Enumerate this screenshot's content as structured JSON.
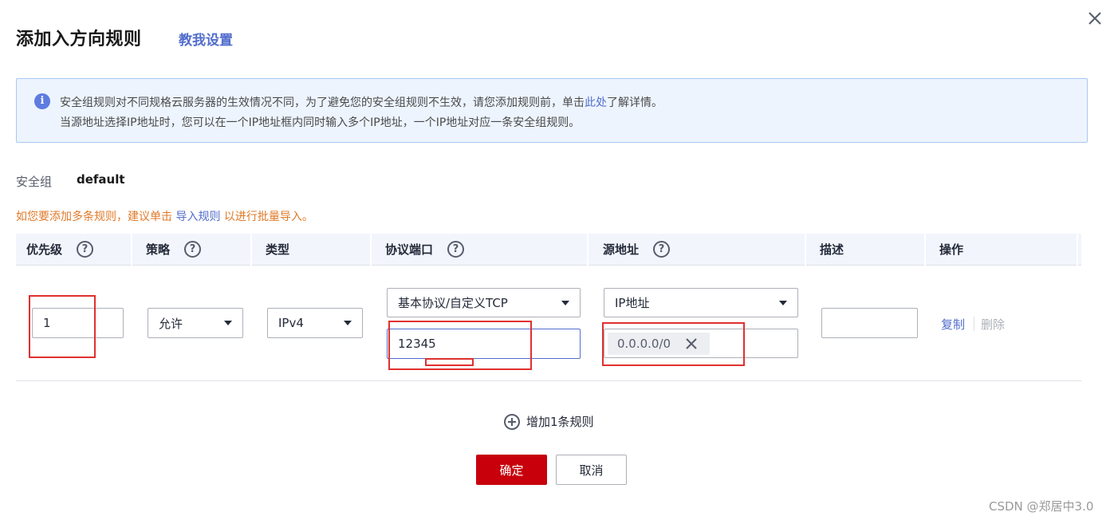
{
  "dialog": {
    "title": "添加入方向规则",
    "guide_link": "教我设置"
  },
  "info": {
    "line1_before": "安全组规则对不同规格云服务器的生效情况不同，为了避免您的安全组规则不生效，请您添加规则前，单击",
    "line1_link": "此处",
    "line1_after": "了解详情。",
    "line2": "当源地址选择IP地址时，您可以在一个IP地址框内同时输入多个IP地址，一个IP地址对应一条安全组规则。"
  },
  "security_group": {
    "label": "安全组",
    "value": "default"
  },
  "hint": {
    "before": "如您要添加多条规则，建议单击 ",
    "link": "导入规则",
    "after": " 以进行批量导入。"
  },
  "table": {
    "columns": {
      "priority": "优先级",
      "action": "策略",
      "type": "类型",
      "protocol_port": "协议端口",
      "source": "源地址",
      "description": "描述",
      "operation": "操作"
    },
    "help_glyph": "?",
    "row": {
      "priority": "1",
      "action": "允许",
      "type": "IPv4",
      "protocol": "基本协议/自定义TCP",
      "port": "12345",
      "source_type": "IP地址",
      "source_value": "0.0.0.0/0",
      "description": "",
      "copy": "复制",
      "delete": "删除"
    }
  },
  "add_rule": "增加1条规则",
  "buttons": {
    "ok": "确定",
    "cancel": "取消"
  },
  "watermark": "CSDN @郑居中3.0",
  "colors": {
    "primary_link": "#526ecc",
    "confirm": "#c7000b",
    "hint": "#e07a29",
    "info_bg": "#edf4fe",
    "annotation": "#e03030"
  }
}
